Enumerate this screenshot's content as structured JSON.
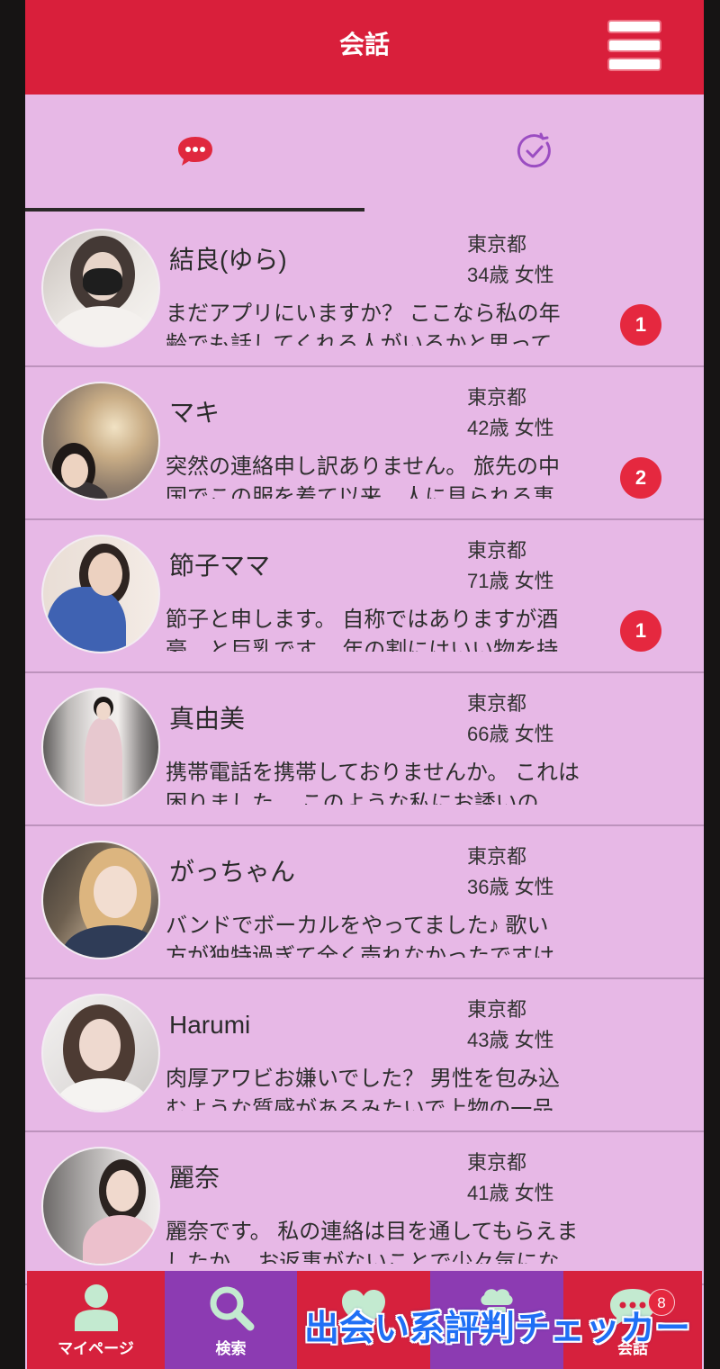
{
  "header": {
    "title": "会話",
    "menu_icon": "hamburger-menu-icon"
  },
  "tabs": [
    {
      "icon": "chat-bubble-icon",
      "active": true
    },
    {
      "icon": "clock-check-icon",
      "active": false
    }
  ],
  "conversations": [
    {
      "name": "結良(ゆら)",
      "location": "東京都",
      "age_gender": "34歳 女性",
      "preview_lines": [
        "まだアプリにいますか？ ここなら私の年",
        "齢でも話してくれる人がいるかと思って"
      ],
      "unread": "1"
    },
    {
      "name": "マキ",
      "location": "東京都",
      "age_gender": "42歳 女性",
      "preview_lines": [
        "突然の連絡申し訳ありません。 旅先の中",
        "国でこの服を着て以来、人に見られる事"
      ],
      "unread": "2"
    },
    {
      "name": "節子ママ",
      "location": "東京都",
      "age_gender": "71歳 女性",
      "preview_lines": [
        "節子と申します。 自称ではありますが酒",
        "豪、と巨乳です。 年の割にはいい物を持"
      ],
      "unread": "1"
    },
    {
      "name": "真由美",
      "location": "東京都",
      "age_gender": "66歳 女性",
      "preview_lines": [
        "携帯電話を携帯しておりませんか。 これは",
        "困りました。 このような私にお誘いの"
      ]
    },
    {
      "name": "がっちゃん",
      "location": "東京都",
      "age_gender": "36歳 女性",
      "preview_lines": [
        "バンドでボーカルをやってました♪ 歌い",
        "方が独特過ぎて全く売れなかったですけ"
      ]
    },
    {
      "name": "Harumi",
      "location": "東京都",
      "age_gender": "43歳 女性",
      "preview_lines": [
        "肉厚アワビお嫌いでした？ 男性を包み込",
        "むような質感があるみたいで上物の一品"
      ]
    },
    {
      "name": "麗奈",
      "location": "東京都",
      "age_gender": "41歳 女性",
      "preview_lines": [
        "麗奈です。 私の連絡は目を通してもらえま",
        "したか。 お返事がないことで少々気にな"
      ]
    }
  ],
  "bottom_nav": [
    {
      "label": "マイページ",
      "icon": "person-icon"
    },
    {
      "label": "検索",
      "icon": "search-icon"
    },
    {
      "icon": "heart-icon"
    },
    {
      "icon": "chef-hat-icon"
    },
    {
      "label": "会話",
      "icon": "chat-icon",
      "badge": "8"
    }
  ],
  "watermark": "出会い系評判チェッカー",
  "colors": {
    "header": "#d91f3b",
    "background": "#e7b8e6",
    "badge": "#e5283f",
    "nav_red": "#d6213d",
    "nav_purple": "#8c3bb2",
    "nav_icon": "#c3ead0",
    "watermark": "#1f6ff5"
  }
}
